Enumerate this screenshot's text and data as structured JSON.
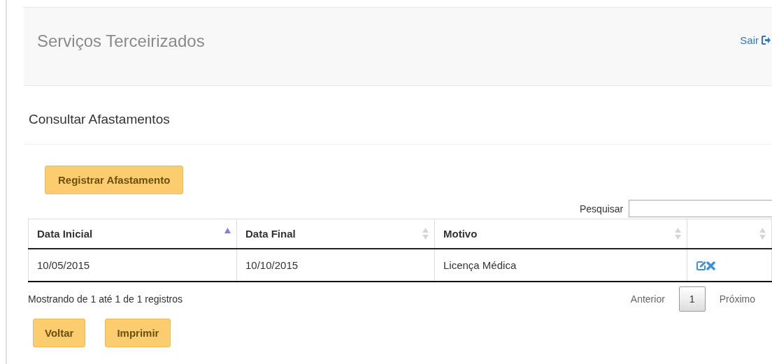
{
  "header": {
    "title": "Serviços Terceirizados",
    "logout": "Sair"
  },
  "page_title": "Consultar Afastamentos",
  "register_button": "Registrar Afastamento",
  "search": {
    "label": "Pesquisar"
  },
  "table": {
    "columns": [
      {
        "label": "Data Inicial",
        "sorted": true
      },
      {
        "label": "Data Final",
        "sorted": false
      },
      {
        "label": "Motivo",
        "sorted": false
      },
      {
        "sorted": false
      }
    ],
    "rows": [
      {
        "cells": [
          "10/05/2015",
          "10/10/2015",
          "Licença Médica"
        ],
        "actions": [
          {
            "kind": "edit"
          },
          {
            "kind": "delete"
          }
        ]
      }
    ]
  },
  "info": "Mostrando de 1 até 1 de 1 registros",
  "pagination": {
    "previous": "Anterior",
    "pages": [
      {
        "label": "1",
        "selected": true
      }
    ],
    "next": "Próximo"
  },
  "buttons": [
    "Voltar",
    "Imprimir"
  ]
}
